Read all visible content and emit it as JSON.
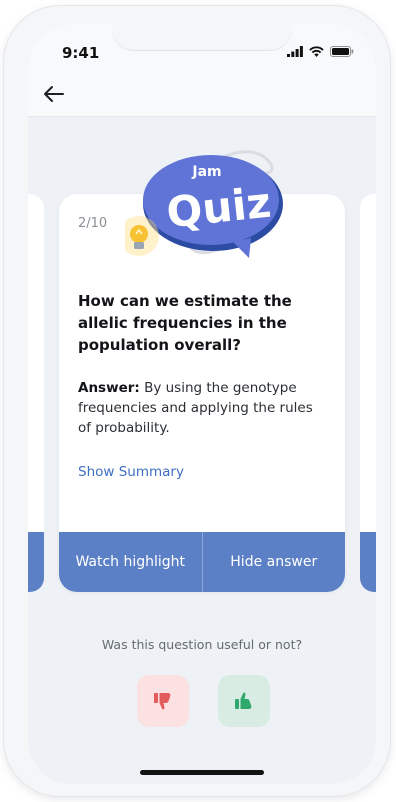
{
  "status_bar": {
    "time": "9:41"
  },
  "logo": {
    "top_word": "Jam",
    "main_word": "Quiz"
  },
  "quiz_card": {
    "counter": "2/10",
    "question": "How can we estimate the allelic frequencies in the population overall?",
    "answer_label": "Answer:",
    "answer_text": " By using the genotype frequencies and applying the rules of probability.",
    "summary_link": "Show Summary",
    "watch_button": "Watch highlight",
    "hide_button": "Hide answer"
  },
  "feedback": {
    "prompt": "Was this question useful or not?"
  },
  "colors": {
    "accent": "#5c80c5",
    "link": "#3f6fc0",
    "thumbs_down": "#e35b5b",
    "thumbs_up": "#2ea86d"
  },
  "icons": {
    "back": "arrow-left-icon",
    "down": "thumbs-down-icon",
    "up": "thumbs-up-icon"
  }
}
